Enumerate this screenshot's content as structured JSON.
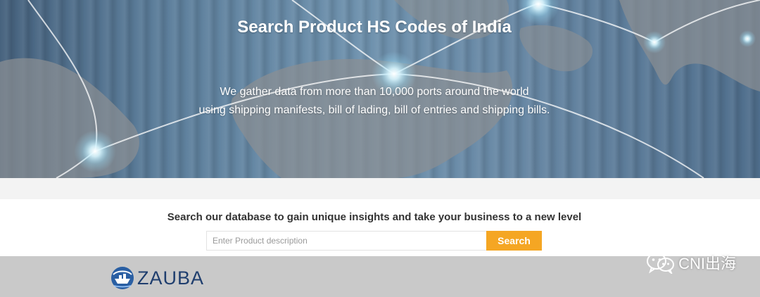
{
  "hero": {
    "title": "Search Product HS Codes of India",
    "subtitle_line1": "We gather data from more than 10,000 ports around the world",
    "subtitle_line2": "using shipping manifests, bill of lading, bill of entries and shipping bills.",
    "background": "world-map-network"
  },
  "search": {
    "heading": "Search our database to gain unique insights and take your business to a new level",
    "placeholder": "Enter Product description",
    "value": "",
    "button_label": "Search"
  },
  "footer": {
    "logo_text": "ZAUBA",
    "logo_icon": "ship-globe-icon"
  },
  "watermark": {
    "text": "CNI出海",
    "icon": "wechat-icon"
  },
  "colors": {
    "accent": "#f5a623",
    "brand": "#1f3e6e",
    "hero_bg": "#5d7f9c",
    "footer_bg": "#c9c9c9"
  }
}
